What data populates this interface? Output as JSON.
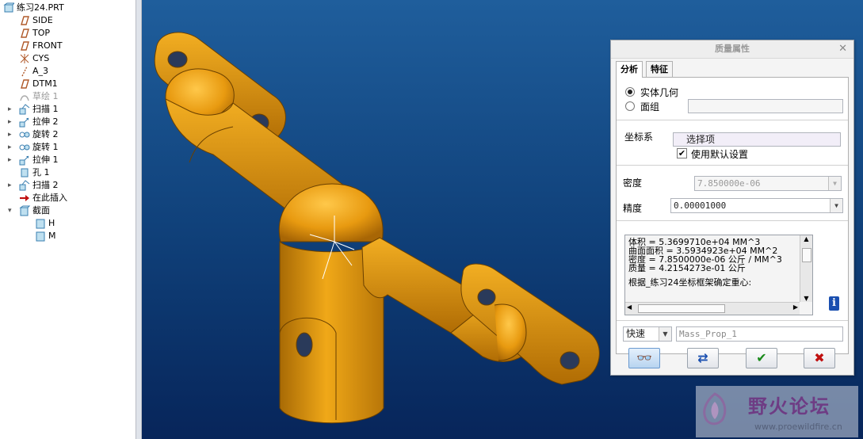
{
  "tree": {
    "root": "练习24.PRT",
    "items": [
      {
        "label": "SIDE",
        "icon": "datum-plane-icon",
        "expand": ""
      },
      {
        "label": "TOP",
        "icon": "datum-plane-icon",
        "expand": ""
      },
      {
        "label": "FRONT",
        "icon": "datum-plane-icon",
        "expand": ""
      },
      {
        "label": "CYS",
        "icon": "coordinate-system-icon",
        "expand": ""
      },
      {
        "label": "A_3",
        "icon": "datum-axis-icon",
        "expand": ""
      },
      {
        "label": "DTM1",
        "icon": "datum-plane-icon",
        "expand": ""
      },
      {
        "label": "草绘 1",
        "icon": "sketch-icon",
        "expand": "",
        "dim": true
      },
      {
        "label": "扫描 1",
        "icon": "sweep-icon",
        "expand": "▸"
      },
      {
        "label": "拉伸 2",
        "icon": "extrude-icon",
        "expand": "▸"
      },
      {
        "label": "旋转 2",
        "icon": "revolve-icon",
        "expand": "▸"
      },
      {
        "label": "旋转 1",
        "icon": "revolve-icon",
        "expand": "▸"
      },
      {
        "label": "拉伸 1",
        "icon": "extrude-icon",
        "expand": "▸"
      },
      {
        "label": "孔 1",
        "icon": "hole-icon",
        "expand": ""
      },
      {
        "label": "扫描 2",
        "icon": "sweep-icon",
        "expand": "▸"
      },
      {
        "label": "在此插入",
        "icon": "insert-arrow-icon",
        "expand": ""
      },
      {
        "label": "截面",
        "icon": "section-icon",
        "expand": "▾"
      }
    ],
    "sub_items": [
      "H",
      "M"
    ]
  },
  "dialog": {
    "title": "质量属性",
    "tabs": [
      "分析",
      "特征"
    ],
    "radio_solid": "实体几何",
    "radio_quilt": "面组",
    "csys_label": "坐标系",
    "select_btn": "选择项",
    "use_default": "使用默认设置",
    "density_label": "密度",
    "density_value": "7.850000e-06",
    "accuracy_label": "精度",
    "accuracy_value": "0.00001000",
    "results": [
      "体积 =  5.3699710e+04  MM^3",
      "曲面面积 =  3.5934923e+04  MM^2",
      "密度 =  7.8500000e-06 公斤 / MM^3",
      "质量 =  4.2154273e-01 公斤"
    ],
    "results_note": "根据_练习24坐标框架确定重心:",
    "mode_value": "快速",
    "name_value": "Mass_Prop_1"
  },
  "watermark": {
    "title": "野火论坛",
    "url": "www.proewildfire.cn"
  },
  "colors": {
    "part": "#e09a12",
    "viewport_top": "#1f5e9c",
    "viewport_bottom": "#07255a",
    "accent": "#1a7a1a",
    "cancel": "#c01010"
  }
}
